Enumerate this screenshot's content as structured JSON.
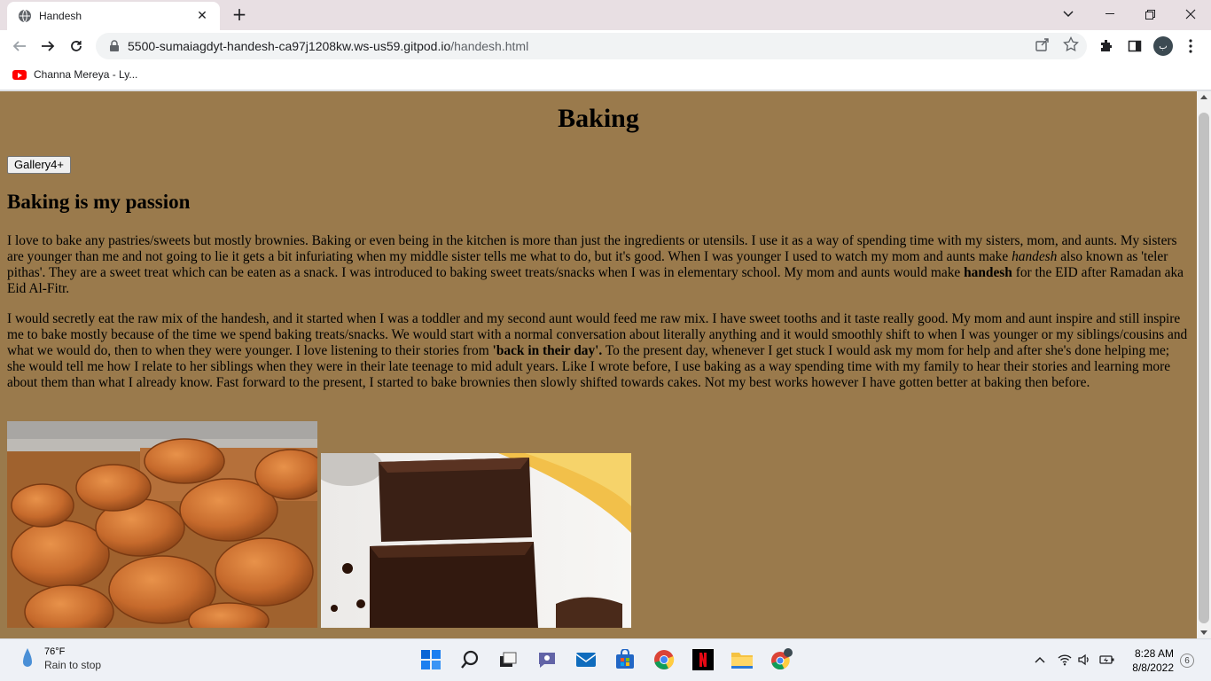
{
  "browser": {
    "tab_title": "Handesh",
    "url_host": "5500-sumaiagdyt-handesh-ca97j1208kw.ws-us59.gitpod.io",
    "url_path": "/handesh.html",
    "bookmark_label": "Channa Mereya - Ly...",
    "profile_initial": "ب"
  },
  "page": {
    "title": "Baking",
    "gallery_button": "Gallery4+",
    "subheading": "Baking is my passion",
    "p1": {
      "t1": "I love to bake any pastries/sweets but mostly brownies. Baking or even being in the kitchen is more than just the ingredients or utensils. I use it as a way of spending time with my sisters, mom, and aunts. My sisters are younger than me and not going to lie it gets a bit infuriating when my middle sister tells me what to do, but it's good. When I was younger I used to watch my mom and aunts make ",
      "em": "handesh",
      "t2": " also known as 'teler pithas'. They are a sweet treat which can be eaten as a snack. I was introduced to baking sweet treats/snacks when I was in elementary school. My mom and aunts would make ",
      "strong": "handesh",
      "t3": " for the EID after Ramadan aka Eid Al-Fitr."
    },
    "p2": {
      "t1": "I would secretly eat the raw mix of the handesh, and it started when I was a toddler and my second aunt would feed me raw mix. I have sweet tooths and it taste really good. My mom and aunt inspire and still inspire me to bake mostly because of the time we spend baking treats/snacks. We would start with a normal conversation about literally anything and it would smoothly shift to when I was younger or my siblings/cousins and what we would do, then to when they were younger. I love listening to their stories from ",
      "strong": "'back in their day'.",
      "t2": " To the present day, whenever I get stuck I would ask my mom for help and after she's done helping me; she would tell me how I relate to her siblings when they were in their late teenage to mid adult years. Like I wrote before, I use baking as a way spending time with my family to hear their stories and learning more about them than what I already know. Fast forward to the present, I started to bake brownies then slowly shifted towards cakes. Not my best works however I have gotten better at baking then before."
    }
  },
  "taskbar": {
    "temperature": "76°F",
    "weather_condition": "Rain to stop",
    "time": "8:28 AM",
    "date": "8/8/2022",
    "notification_count": "6"
  }
}
